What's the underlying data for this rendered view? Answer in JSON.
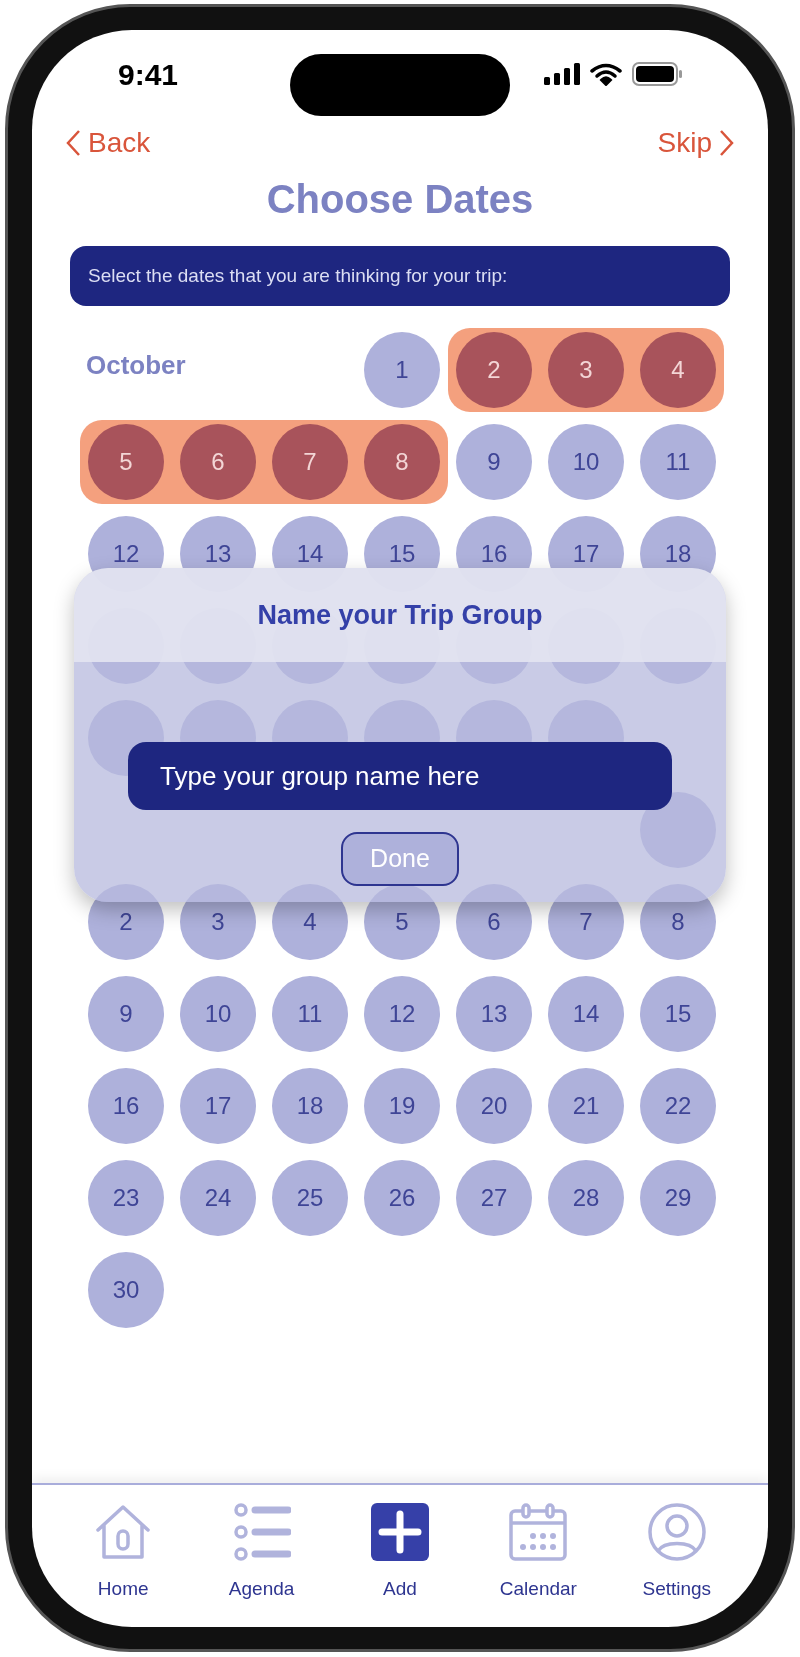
{
  "status_bar": {
    "time": "9:41"
  },
  "nav": {
    "back": "Back",
    "skip": "Skip"
  },
  "title": "Choose Dates",
  "instruction": "Select the dates that you are thinking for your trip:",
  "months": [
    {
      "name": "October",
      "weeks": [
        {
          "right_aligned": true,
          "days": [
            {
              "day": "1",
              "selected": false
            },
            {
              "day": "2",
              "selected": true
            },
            {
              "day": "3",
              "selected": true
            },
            {
              "day": "4",
              "selected": true
            }
          ]
        },
        {
          "days": [
            {
              "day": "5",
              "selected": true
            },
            {
              "day": "6",
              "selected": true
            },
            {
              "day": "7",
              "selected": true
            },
            {
              "day": "8",
              "selected": true
            },
            {
              "day": "9",
              "selected": false
            },
            {
              "day": "10",
              "selected": false
            },
            {
              "day": "11",
              "selected": false
            }
          ]
        },
        {
          "days": [
            {
              "day": "12",
              "selected": false
            },
            {
              "day": "13",
              "selected": false
            },
            {
              "day": "14",
              "selected": false
            },
            {
              "day": "15",
              "selected": false
            },
            {
              "day": "16",
              "selected": false
            },
            {
              "day": "17",
              "selected": false
            },
            {
              "day": "18",
              "selected": false
            }
          ]
        },
        {
          "days": [
            {
              "selected": false
            },
            {
              "selected": false
            },
            {
              "selected": false
            },
            {
              "selected": false
            },
            {
              "selected": false
            },
            {
              "selected": false
            },
            {
              "selected": false
            }
          ]
        },
        {
          "right_aligned": false,
          "days": [
            {
              "selected": false
            },
            {
              "selected": false
            },
            {
              "selected": false
            },
            {
              "selected": false
            },
            {
              "selected": false
            },
            {
              "selected": false
            }
          ]
        }
      ]
    },
    {
      "weeks": [
        {
          "right_aligned": true,
          "days": [
            {
              "selected": false
            }
          ]
        },
        {
          "days": [
            {
              "day": "2",
              "selected": false
            },
            {
              "day": "3",
              "selected": false
            },
            {
              "day": "4",
              "selected": false
            },
            {
              "day": "5",
              "selected": false
            },
            {
              "day": "6",
              "selected": false
            },
            {
              "day": "7",
              "selected": false
            },
            {
              "day": "8",
              "selected": false
            }
          ]
        },
        {
          "days": [
            {
              "day": "9",
              "selected": false
            },
            {
              "day": "10",
              "selected": false
            },
            {
              "day": "11",
              "selected": false
            },
            {
              "day": "12",
              "selected": false
            },
            {
              "day": "13",
              "selected": false
            },
            {
              "day": "14",
              "selected": false
            },
            {
              "day": "15",
              "selected": false
            }
          ]
        },
        {
          "days": [
            {
              "day": "16",
              "selected": false
            },
            {
              "day": "17",
              "selected": false
            },
            {
              "day": "18",
              "selected": false
            },
            {
              "day": "19",
              "selected": false
            },
            {
              "day": "20",
              "selected": false
            },
            {
              "day": "21",
              "selected": false
            },
            {
              "day": "22",
              "selected": false
            }
          ]
        },
        {
          "days": [
            {
              "day": "23",
              "selected": false
            },
            {
              "day": "24",
              "selected": false
            },
            {
              "day": "25",
              "selected": false
            },
            {
              "day": "26",
              "selected": false
            },
            {
              "day": "27",
              "selected": false
            },
            {
              "day": "28",
              "selected": false
            },
            {
              "day": "29",
              "selected": false
            }
          ]
        },
        {
          "right_aligned": false,
          "days": [
            {
              "day": "30",
              "selected": false
            }
          ]
        }
      ]
    }
  ],
  "dialog": {
    "title": "Name your Trip Group",
    "input": {
      "placeholder": "Type your group name here"
    },
    "button": "Done"
  },
  "tab_bar": [
    {
      "kind": "home",
      "label": "Home"
    },
    {
      "kind": "agenda",
      "label": "Agenda"
    },
    {
      "kind": "add",
      "label": "Add"
    },
    {
      "kind": "calendar",
      "label": "Calendar"
    },
    {
      "kind": "settings",
      "label": "Settings"
    }
  ]
}
